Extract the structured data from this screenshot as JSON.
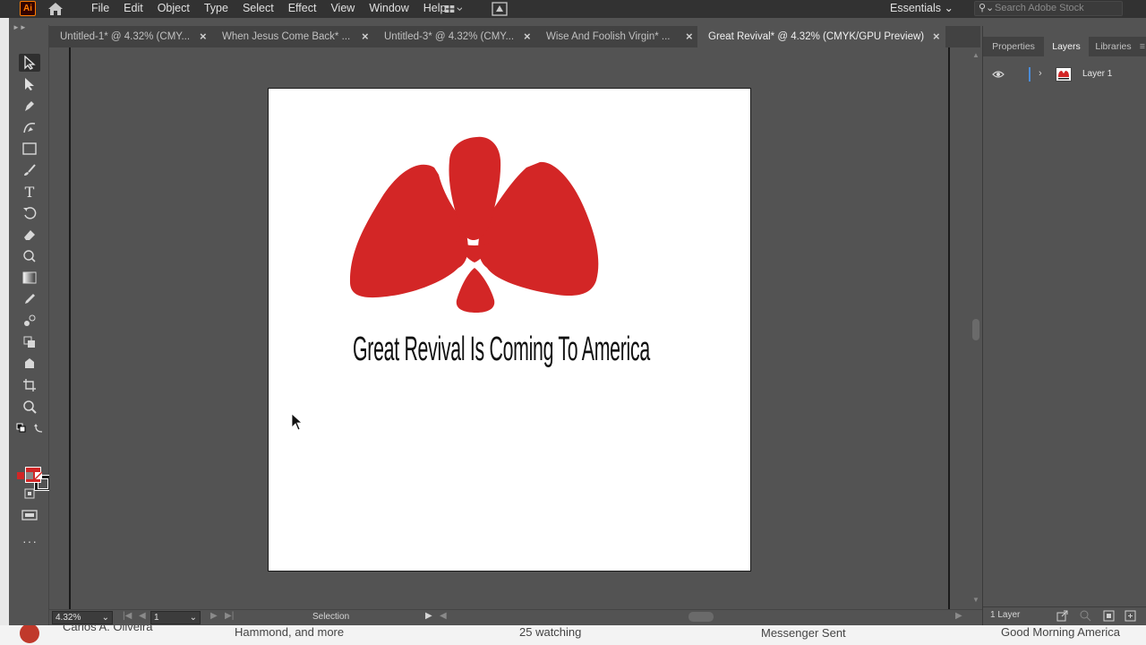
{
  "app": {
    "logo_text": "Ai",
    "menu": [
      "File",
      "Edit",
      "Object",
      "Type",
      "Select",
      "Effect",
      "View",
      "Window",
      "Help"
    ],
    "workspace": "Essentials",
    "search_placeholder": "Search Adobe Stock"
  },
  "tabs": [
    {
      "label": "Untitled-1* @ 4.32% (CMY...",
      "active": false
    },
    {
      "label": "When Jesus Come Back* ...",
      "active": false
    },
    {
      "label": "Untitled-3* @ 4.32% (CMY...",
      "active": false
    },
    {
      "label": "Wise And Foolish Virgin* ...",
      "active": false
    },
    {
      "label": "Great Revival* @ 4.32% (CMYK/GPU Preview)",
      "active": true
    }
  ],
  "artboard": {
    "headline": "Great Revival Is Coming To America",
    "logo_color": "#d32626"
  },
  "status": {
    "zoom": "4.32%",
    "page": "1",
    "tool": "Selection"
  },
  "panels": {
    "tabs": [
      "Properties",
      "Layers",
      "Libraries"
    ],
    "active_tab": "Layers",
    "layers": [
      {
        "name": "Layer 1"
      }
    ],
    "layer_count": "1 Layer"
  },
  "colors": {
    "fill": "#d12626",
    "accent": "#4a8bd6",
    "app_logo": "#ff7c00"
  },
  "bottom_strip": {
    "items": [
      "Carlos A. Oliveira",
      "Hammond, and more",
      "25 watching",
      "Messenger Sent",
      "Good Morning America"
    ]
  }
}
